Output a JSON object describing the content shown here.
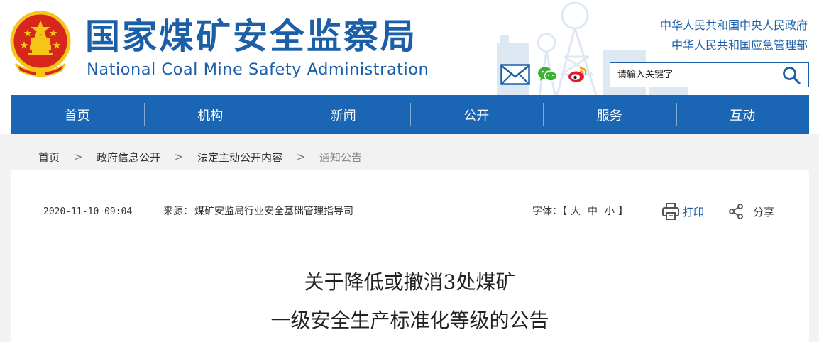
{
  "header": {
    "title_cn": "国家煤矿安全监察局",
    "title_en": "National Coal Mine Safety Administration",
    "gov_links": [
      "中华人民共和国中央人民政府",
      "中华人民共和国应急管理部"
    ],
    "search": {
      "placeholder": "请输入关键字"
    },
    "icons": [
      "mail-icon",
      "wechat-icon",
      "weibo-icon",
      "search-icon"
    ]
  },
  "nav": {
    "items": [
      "首页",
      "机构",
      "新闻",
      "公开",
      "服务",
      "互动"
    ]
  },
  "breadcrumb": {
    "items": [
      "首页",
      "政府信息公开",
      "法定主动公开内容",
      "通知公告"
    ],
    "separator": ">"
  },
  "article": {
    "date": "2020-11-10 09:04",
    "source_label": "来源：",
    "source": "煤矿安监局行业安全基础管理指导司",
    "font_label": "字体：",
    "font_open": "【",
    "font_close": "】",
    "font_options": [
      "大",
      "中",
      "小"
    ],
    "print_label": "打印",
    "share_label": "分享",
    "title_lines": [
      "关于降低或撤消3处煤矿",
      "一级安全生产标准化等级的公告"
    ]
  },
  "colors": {
    "brand_blue": "#1a5fa8",
    "nav_blue": "#1a66b5",
    "emblem_red": "#d7261b",
    "emblem_gold": "#f5c518",
    "wechat_green": "#3cb034",
    "weibo_red": "#e6162d",
    "gray_bg": "#f2f2f2"
  }
}
